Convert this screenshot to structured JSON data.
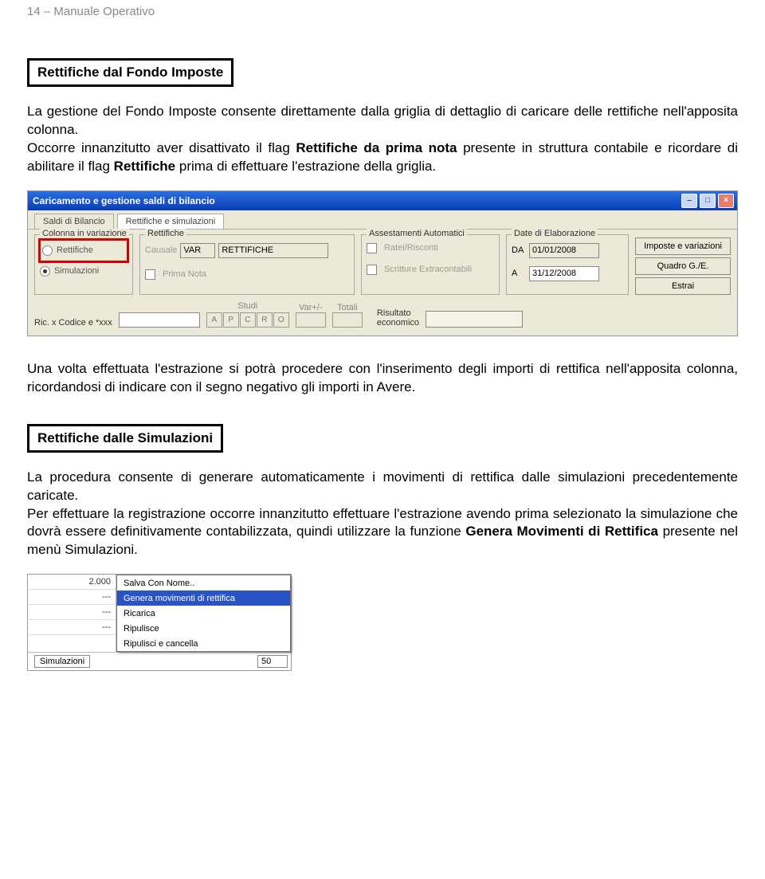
{
  "page_header": "14 – Manuale Operativo",
  "section1": {
    "title": "Rettifiche dal Fondo Imposte",
    "p1": "La gestione del Fondo Imposte consente direttamente dalla griglia di dettaglio di caricare delle rettifiche nell'apposita colonna.",
    "p2a": "Occorre innanzitutto aver disattivato il flag ",
    "p2b": "Rettifiche da prima nota",
    "p2c": " presente in struttura contabile e ricordare di abilitare il flag ",
    "p2d": "Rettifiche",
    "p2e": " prima di effettuare l'estrazione della griglia."
  },
  "win1": {
    "title": "Caricamento e gestione saldi di bilancio",
    "tabs": [
      "Saldi di Bilancio",
      "Rettifiche e simulazioni"
    ],
    "groups": {
      "col_var": "Colonna in variazione",
      "rettifiche": "Rettifiche",
      "assest": "Assestamenti Automatici",
      "date": "Date di Elaborazione"
    },
    "radio_rettifiche": "Rettifiche",
    "radio_simulazioni": "Simulazioni",
    "causale_lbl": "Causale",
    "causale_code": "VAR",
    "causale_desc": "RETTIFICHE",
    "prima_nota": "Prima Nota",
    "ratei": "Ratei/Risconti",
    "scritture": "Scritture Extracontabili",
    "da_lbl": "DA",
    "a_lbl": "A",
    "da_val": "01/01/2008",
    "a_val": "31/12/2008",
    "btn_imposte": "Imposte e variazioni",
    "btn_quadro": "Quadro G./E.",
    "btn_estrai": "Estrai",
    "ric_label": "Ric. x Codice e *xxx",
    "studi": "Studi",
    "varpm": "Var+/-",
    "totali": "Totali",
    "letters": [
      "A",
      "P",
      "C",
      "R",
      "O"
    ],
    "risultato": "Risultato\neconomico"
  },
  "after_win1": "Una volta effettuata l'estrazione si potrà procedere con l'inserimento degli importi di rettifica nell'apposita colonna, ricordandosi di indicare con il segno negativo gli importi in Avere.",
  "section2": {
    "title": "Rettifiche dalle Simulazioni",
    "p1": "La procedura consente di generare automaticamente i movimenti di rettifica dalle simulazioni precedentemente caricate.",
    "p2a": "Per effettuare la registrazione occorre innanzitutto effettuare l'estrazione avendo prima selezionato la simulazione che dovrà essere definitivamente contabilizzata, quindi utilizzare la funzione ",
    "p2b": "Genera Movimenti di Rettifica",
    "p2c": " presente nel menù Simulazioni."
  },
  "win2": {
    "left_cells": [
      "2.000",
      "---",
      "---",
      "---"
    ],
    "menu": [
      "Salva Con Nome..",
      "Genera movimenti di rettifica",
      "Ricarica",
      "Ripulisce",
      "Ripulisci e cancella"
    ],
    "sim_label": "Simulazioni",
    "num": "50"
  }
}
